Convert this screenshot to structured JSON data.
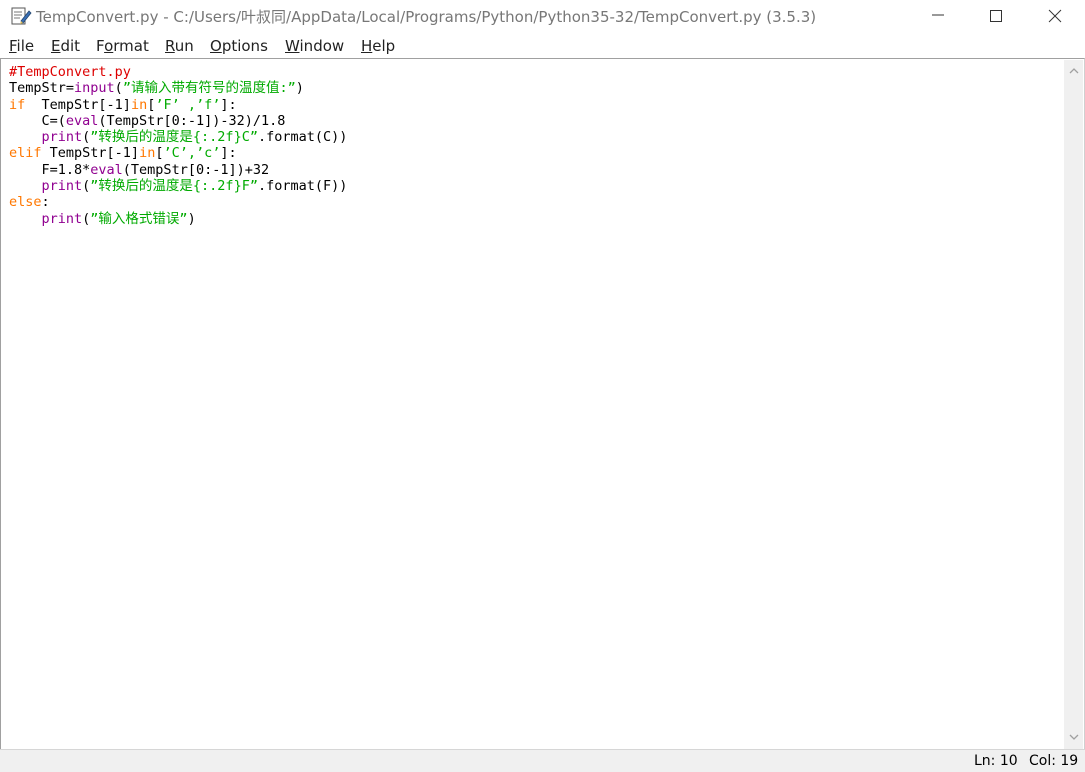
{
  "window": {
    "title": "TempConvert.py - C:/Users/叶叔同/AppData/Local/Programs/Python/Python35-32/TempConvert.py (3.5.3)",
    "minimize_icon": "minimize-icon",
    "maximize_icon": "maximize-icon",
    "close_icon": "close-icon"
  },
  "menu": {
    "items": [
      {
        "ul": "F",
        "rest": "ile"
      },
      {
        "ul": "E",
        "rest": "dit"
      },
      {
        "pre": "F",
        "ul": "o",
        "rest": "rmat"
      },
      {
        "ul": "R",
        "rest": "un"
      },
      {
        "ul": "O",
        "rest": "ptions"
      },
      {
        "ul": "W",
        "rest": "indow"
      },
      {
        "ul": "H",
        "rest": "elp"
      }
    ]
  },
  "editor": {
    "lines": [
      [
        {
          "t": "#TempConvert.py",
          "c": "comment"
        }
      ],
      [
        {
          "t": "TempStr=",
          "c": "plain"
        },
        {
          "t": "input",
          "c": "builtin"
        },
        {
          "t": "(",
          "c": "plain"
        },
        {
          "t": "”请输入带有符号的温度值:”",
          "c": "string"
        },
        {
          "t": ")",
          "c": "plain"
        }
      ],
      [
        {
          "t": "if",
          "c": "keyword"
        },
        {
          "t": "  TempStr[-1]",
          "c": "plain"
        },
        {
          "t": "in",
          "c": "keyword"
        },
        {
          "t": "[",
          "c": "plain"
        },
        {
          "t": "’F’ ,’f’",
          "c": "string"
        },
        {
          "t": "]:",
          "c": "plain"
        }
      ],
      [
        {
          "t": "    C=(",
          "c": "plain"
        },
        {
          "t": "eval",
          "c": "builtin"
        },
        {
          "t": "(TempStr[0:-1])-32)/1.8",
          "c": "plain"
        }
      ],
      [
        {
          "t": "    ",
          "c": "plain"
        },
        {
          "t": "print",
          "c": "builtin"
        },
        {
          "t": "(",
          "c": "plain"
        },
        {
          "t": "”转换后的温度是{:.2f}C”",
          "c": "string"
        },
        {
          "t": ".format(C))",
          "c": "plain"
        }
      ],
      [
        {
          "t": "elif",
          "c": "keyword"
        },
        {
          "t": " TempStr[-1]",
          "c": "plain"
        },
        {
          "t": "in",
          "c": "keyword"
        },
        {
          "t": "[",
          "c": "plain"
        },
        {
          "t": "’C’,’c’",
          "c": "string"
        },
        {
          "t": "]:",
          "c": "plain"
        }
      ],
      [
        {
          "t": "    F=1.8*",
          "c": "plain"
        },
        {
          "t": "eval",
          "c": "builtin"
        },
        {
          "t": "(TempStr[0:-1])+32",
          "c": "plain"
        }
      ],
      [
        {
          "t": "    ",
          "c": "plain"
        },
        {
          "t": "print",
          "c": "builtin"
        },
        {
          "t": "(",
          "c": "plain"
        },
        {
          "t": "”转换后的温度是{:.2f}F”",
          "c": "string"
        },
        {
          "t": ".format(F))",
          "c": "plain"
        }
      ],
      [
        {
          "t": "else",
          "c": "keyword"
        },
        {
          "t": ":",
          "c": "plain"
        }
      ],
      [
        {
          "t": "    ",
          "c": "plain"
        },
        {
          "t": "print",
          "c": "builtin"
        },
        {
          "t": "(",
          "c": "plain"
        },
        {
          "t": "”输入格式错误”",
          "c": "string"
        },
        {
          "t": ")",
          "c": "plain"
        }
      ]
    ]
  },
  "status": {
    "ln": "Ln: 10",
    "col": "Col: 19"
  },
  "colors": {
    "comment": "#dd0000",
    "keyword": "#ff7700",
    "builtin": "#900090",
    "string": "#00aa00"
  }
}
